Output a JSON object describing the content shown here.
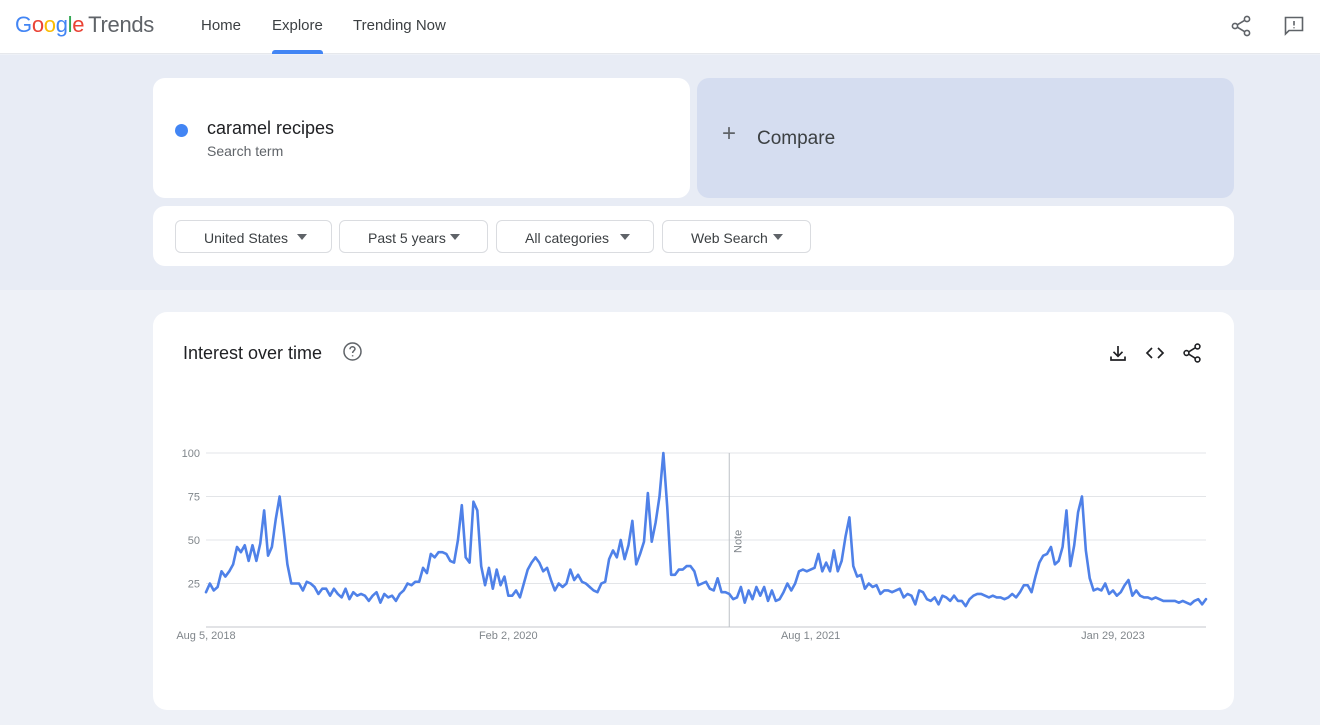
{
  "header": {
    "logo": {
      "g1": "G",
      "g2": "o",
      "g3": "o",
      "g4": "g",
      "g5": "l",
      "g6": "e",
      "product": "Trends"
    },
    "nav": [
      {
        "label": "Home"
      },
      {
        "label": "Explore",
        "active": true
      },
      {
        "label": "Trending Now"
      }
    ],
    "icons": [
      "share-icon",
      "feedback-icon"
    ]
  },
  "search": {
    "term": "caramel recipes",
    "term_type": "Search term",
    "term_color": "#4285f4",
    "compare_label": "Compare"
  },
  "filters": {
    "region": "United States",
    "time_range": "Past 5 years",
    "category": "All categories",
    "property": "Web Search"
  },
  "chart_card": {
    "title": "Interest over time",
    "icons": [
      "help-icon",
      "download-icon",
      "embed-icon",
      "share-icon"
    ],
    "note": "Note"
  },
  "chart_data": {
    "type": "line",
    "title": "Interest over time",
    "xlabel": "",
    "ylabel": "",
    "ylim": [
      0,
      100
    ],
    "yticks": [
      25,
      50,
      75,
      100
    ],
    "xtick_labels": [
      "Aug 5, 2018",
      "Feb 2, 2020",
      "Aug 1, 2021",
      "Jan 29, 2023"
    ],
    "grid": true,
    "note_marker_index": 135,
    "series": [
      {
        "color": "#4f81e8",
        "values": [
          20,
          25,
          21,
          23,
          32,
          29,
          32,
          36,
          46,
          43,
          47,
          38,
          47,
          38,
          48,
          67,
          41,
          46,
          62,
          75,
          56,
          36,
          25,
          25,
          25,
          21,
          26,
          25,
          23,
          19,
          22,
          22,
          18,
          22,
          19,
          17,
          22,
          16,
          20,
          18,
          19,
          18,
          15,
          18,
          20,
          14,
          19,
          17,
          18,
          15,
          19,
          21,
          25,
          24,
          26,
          26,
          34,
          31,
          42,
          40,
          43,
          43,
          42,
          38,
          37,
          50,
          70,
          40,
          37,
          72,
          67,
          35,
          24,
          34,
          22,
          33,
          24,
          29,
          18,
          18,
          21,
          17,
          25,
          33,
          37,
          40,
          37,
          32,
          34,
          27,
          21,
          25,
          23,
          25,
          33,
          27,
          30,
          26,
          25,
          23,
          21,
          20,
          25,
          26,
          39,
          44,
          40,
          50,
          39,
          47,
          61,
          36,
          42,
          49,
          77,
          49,
          60,
          75,
          100,
          69,
          30,
          30,
          33,
          33,
          35,
          35,
          32,
          24,
          25,
          26,
          22,
          21,
          28,
          20,
          20,
          19,
          16,
          17,
          23,
          14,
          21,
          16,
          23,
          18,
          23,
          15,
          21,
          15,
          16,
          20,
          25,
          21,
          25,
          32,
          33,
          32,
          33,
          34,
          42,
          32,
          37,
          32,
          44,
          32,
          38,
          52,
          63,
          35,
          29,
          30,
          22,
          25,
          23,
          24,
          19,
          21,
          21,
          20,
          21,
          22,
          17,
          19,
          18,
          13,
          21,
          20,
          16,
          15,
          17,
          13,
          18,
          17,
          15,
          18,
          15,
          15,
          12,
          16,
          18,
          19,
          19,
          18,
          17,
          18,
          17,
          17,
          16,
          17,
          19,
          17,
          20,
          24,
          24,
          20,
          29,
          37,
          41,
          42,
          46,
          36,
          38,
          46,
          67,
          35,
          47,
          66,
          75,
          44,
          28,
          21,
          22,
          21,
          25,
          19,
          21,
          18,
          20,
          24,
          27,
          18,
          21,
          18,
          17,
          17,
          16,
          17,
          16,
          15,
          15,
          15,
          15,
          14,
          15,
          14,
          13,
          15,
          16,
          13,
          16
        ]
      }
    ]
  }
}
